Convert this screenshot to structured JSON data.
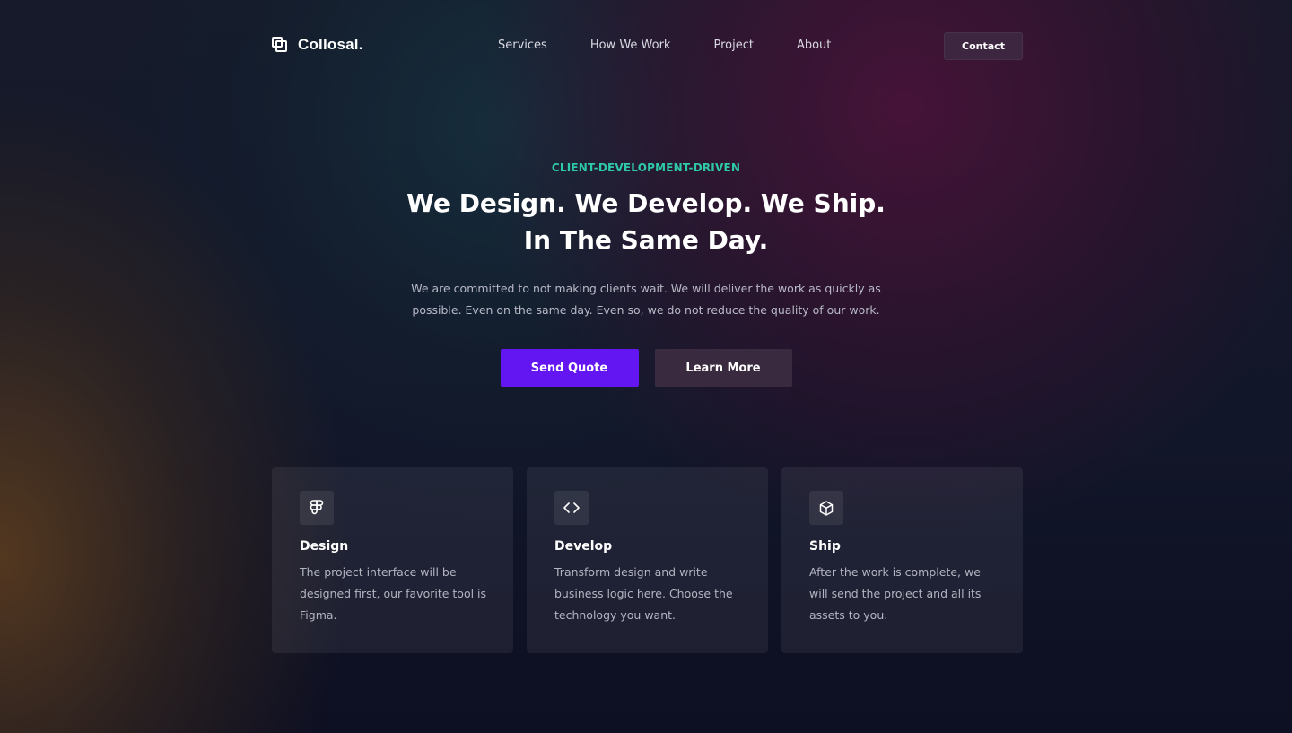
{
  "nav": {
    "brand": "Collosal.",
    "links": [
      "Services",
      "How We Work",
      "Project",
      "About"
    ],
    "contact_label": "Contact"
  },
  "hero": {
    "eyebrow": "CLIENT-DEVELOPMENT-DRIVEN",
    "headline": "We Design. We Develop. We Ship. In The Same Day.",
    "subtext": "We are committed to not making clients wait. We will deliver the work as quickly as possible. Even on the same day. Even so, we do not reduce the quality of our work.",
    "primary_cta": "Send Quote",
    "secondary_cta": "Learn More"
  },
  "cards": [
    {
      "icon": "figma-icon",
      "title": "Design",
      "text": "The project interface will be designed first, our favorite tool is Figma."
    },
    {
      "icon": "code-icon",
      "title": "Develop",
      "text": "Transform design and write business logic here. Choose the technology you want."
    },
    {
      "icon": "cube-icon",
      "title": "Ship",
      "text": "After the work is complete, we will send the project and all its assets to you."
    }
  ],
  "colors": {
    "accent": "#6316f2",
    "eyebrow": "#2ec9a8",
    "secondary_button": "#3a2a40"
  }
}
